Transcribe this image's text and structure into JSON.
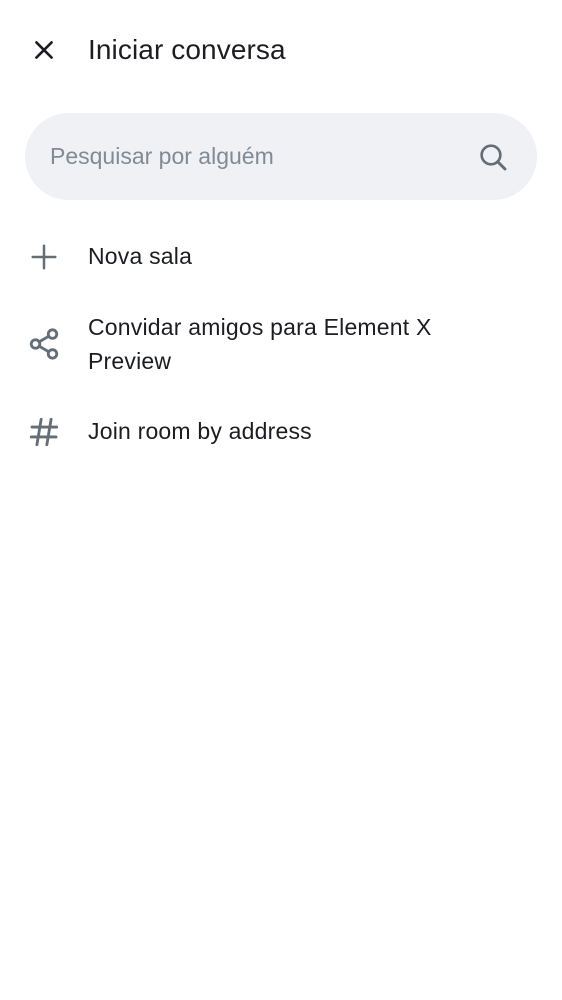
{
  "header": {
    "title": "Iniciar conversa",
    "close_icon": "close-icon"
  },
  "search": {
    "placeholder": "Pesquisar por alguém",
    "value": "",
    "icon": "search-icon"
  },
  "menu": {
    "items": [
      {
        "label": "Nova sala",
        "icon": "plus-icon"
      },
      {
        "label": "Convidar amigos para Element X Preview",
        "icon": "share-icon"
      },
      {
        "label": "Join room by address",
        "icon": "hash-icon"
      }
    ]
  },
  "colors": {
    "icon": "#656d77",
    "text": "#1b1d22",
    "search_bg": "#eff1f5",
    "placeholder": "#818a95"
  }
}
